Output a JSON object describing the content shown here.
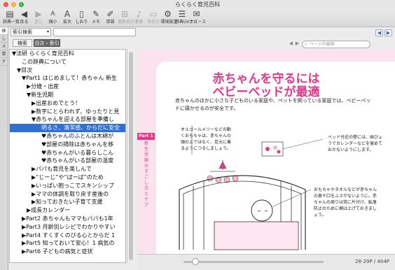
{
  "window": {
    "title": "らくらく育児百科"
  },
  "toolbar": {
    "items": [
      {
        "label": "辞典一覧",
        "icon": "books-icon",
        "disabled": false
      },
      {
        "label": "戻る",
        "icon": "back-arrow-icon",
        "disabled": false
      },
      {
        "label": "進む",
        "icon": "forward-arrow-icon",
        "disabled": true
      },
      {
        "label": "縮小",
        "icon": "font-smaller-icon",
        "disabled": false
      },
      {
        "label": "拡大",
        "icon": "font-larger-icon",
        "disabled": false
      },
      {
        "label": "しおり",
        "icon": "bookmark-icon",
        "disabled": false
      },
      {
        "label": "メモ",
        "icon": "memo-icon",
        "disabled": false
      },
      {
        "label": "単語",
        "icon": "word-icon",
        "disabled": false
      },
      {
        "label": "連動表示する",
        "icon": "link-icon",
        "disabled": true
      },
      {
        "label": "音声",
        "icon": "speaker-icon",
        "disabled": true
      },
      {
        "label": "非表示",
        "icon": "hide-icon",
        "disabled": true
      },
      {
        "label": "環境設定",
        "icon": "settings-icon",
        "disabled": false
      },
      {
        "label": "辞典UVナビ",
        "icon": "navi-icon",
        "disabled": false
      },
      {
        "label": "ニュース",
        "icon": "news-icon",
        "disabled": false
      }
    ]
  },
  "sidebar": {
    "left_tabs": [
      "検",
      "し",
      "メ",
      "単",
      "ナ"
    ],
    "search_select": "索引検索",
    "segments": [
      "検索",
      "目次・索引"
    ],
    "tree": [
      {
        "text": "▼法研 らくらく育児百科",
        "indent": 0
      },
      {
        "text": "この辞典について",
        "indent": 2
      },
      {
        "text": "▼目次",
        "indent": 1
      },
      {
        "text": "▼Part1 はじめまして！赤ちゃん 新生",
        "indent": 2
      },
      {
        "text": "▶分娩・出産",
        "indent": 3
      },
      {
        "text": "▼新生児期",
        "indent": 3
      },
      {
        "text": "▶出産おめでとう！",
        "indent": 4
      },
      {
        "text": "▶数字にとらわれず、ゆったりと見",
        "indent": 4
      },
      {
        "text": "▼赤ちゃんを迎える部屋を準備し",
        "indent": 4
      },
      {
        "text": "明るさ、清潔感、からだに安全",
        "indent": 6,
        "hl": true
      },
      {
        "text": "♥赤ちゃんのふとんは木綿が",
        "indent": 6
      },
      {
        "text": "♥部屋の掃除は赤ちゃんを移",
        "indent": 6
      },
      {
        "text": "♥赤ちゃんがいる暮らしこん",
        "indent": 6
      },
      {
        "text": "♥赤ちゃんがいる部屋の温度",
        "indent": 6
      },
      {
        "text": "▶パパも育児を楽しんで",
        "indent": 4
      },
      {
        "text": "▶“じーじ”や“ばーば”のため",
        "indent": 4
      },
      {
        "text": "▶いっぱい抱っこでスキンシップ",
        "indent": 4
      },
      {
        "text": "▶ママの体調を取り戻す産後の",
        "indent": 4
      },
      {
        "text": "▶知っておきたい子育て支援",
        "indent": 4
      },
      {
        "text": "▶成長カレンダー",
        "indent": 3
      },
      {
        "text": "▶Part2 赤ちゃんもママもパパも1年",
        "indent": 2
      },
      {
        "text": "▶Part3 月齢別レシピでわかりやすい",
        "indent": 2
      },
      {
        "text": "▶Part4 すくすくのびる心とからだ 1",
        "indent": 2
      },
      {
        "text": "▶Part5 知っておいて安心！1 病気の",
        "indent": 2
      },
      {
        "text": "▶Part6 子どもの病気と症状",
        "indent": 2
      }
    ]
  },
  "viewer": {
    "search_placeholder": "ページ内検索",
    "heading_line1": "赤ちゃんを守るには",
    "heading_line2": "ベビーベッドが最適",
    "intro": "赤ちゃんのほかに小さな子どものいる家庭や、ペットを飼っている家庭では、ベビーベッドに寝かせるのが安全です。",
    "side_label": "Part 1",
    "side_vertical": "新生児期のすごし方とケア",
    "note_mobile": "オルゴールメリーなどの動くおもちゃは、赤ちゃんの頭の上ではなく、足元に乗るようにつるしましょう。",
    "note_fence": "ベッド付近の壁には、画びょうでカレンダーなどを留めておかないようにします。",
    "note_towel": "おもちゃやタオルなどが赤ちゃんの鼻や口をふさがないように。赤ちゃんの周りは常に片付け、転落防止のために柵は上げておきましょう。",
    "page_info": "28-29P / 404P",
    "accent": "#e3378a"
  }
}
